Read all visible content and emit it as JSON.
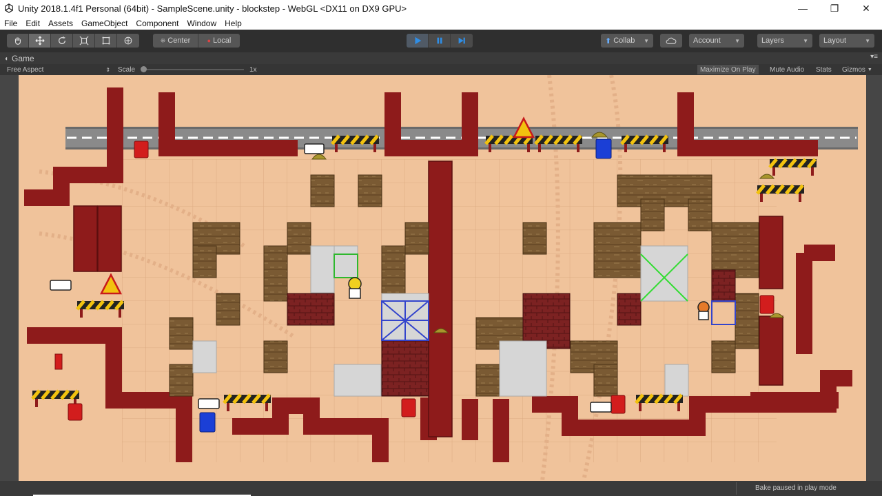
{
  "window": {
    "title": "Unity 2018.1.4f1 Personal (64bit) - SampleScene.unity - blockstep - WebGL <DX11 on DX9 GPU>",
    "minimize_glyph": "—",
    "maximize_glyph": "❐",
    "close_glyph": "✕"
  },
  "menu": [
    "File",
    "Edit",
    "Assets",
    "GameObject",
    "Component",
    "Window",
    "Help"
  ],
  "toolbar": {
    "pivot_center": "Center",
    "pivot_local": "Local",
    "collab": "Collab",
    "account": "Account",
    "layers": "Layers",
    "layout": "Layout",
    "accent": "#2f8ee6"
  },
  "game_panel": {
    "tab": "Game",
    "aspect": "Free Aspect",
    "scale_label": "Scale",
    "scale_value": "1x",
    "maximize": "Maximize On Play",
    "mute": "Mute Audio",
    "stats": "Stats",
    "gizmos": "Gizmos"
  },
  "status": {
    "text": "Bake paused in play mode"
  },
  "game": {
    "floor_color": "#f0c39b",
    "pipe_color": "#8e1b1b",
    "crate_color": "#7a5a33",
    "road_color": "#8a8a8a",
    "brick_color": "#7c2222",
    "stone_color": "#d6d6d6"
  }
}
